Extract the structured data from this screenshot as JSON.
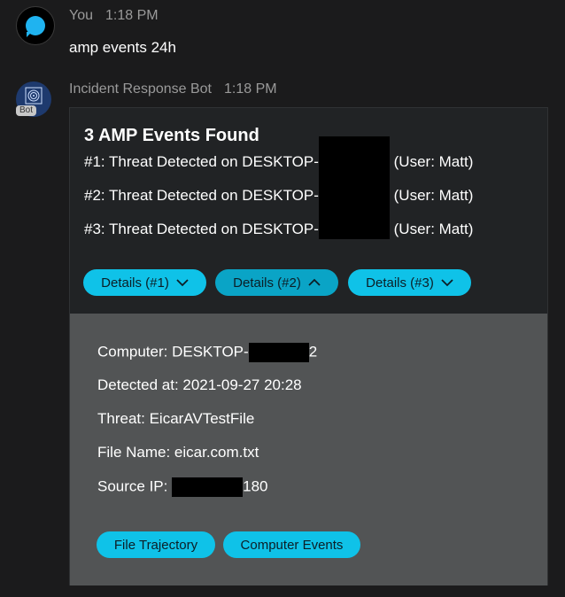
{
  "user_message": {
    "author": "You",
    "time": "1:18 PM",
    "text": "amp events 24h"
  },
  "bot_message": {
    "author": "Incident Response Bot",
    "time": "1:18 PM",
    "bot_badge": "Bot"
  },
  "card": {
    "title": "3 AMP Events Found",
    "events": [
      {
        "prefix": "#1: Threat Detected on DESKTOP-",
        "suffix": "(User: Matt)"
      },
      {
        "prefix": "#2: Threat Detected on DESKTOP-",
        "suffix": "(User: Matt)"
      },
      {
        "prefix": "#3: Threat Detected on DESKTOP-",
        "suffix": "(User: Matt)"
      }
    ],
    "buttons": [
      {
        "label": "Details (#1)",
        "icon": "chevron-down-icon",
        "expanded": false
      },
      {
        "label": "Details (#2)",
        "icon": "chevron-up-icon",
        "expanded": true
      },
      {
        "label": "Details (#3)",
        "icon": "chevron-down-icon",
        "expanded": false
      }
    ]
  },
  "details": {
    "computer_prefix": "Computer: DESKTOP-",
    "computer_suffix": "2",
    "detected_at": "Detected at: 2021-09-27 20:28",
    "threat": "Threat: EicarAVTestFile",
    "file_name": "File Name: eicar.com.txt",
    "source_ip_prefix": "Source IP: ",
    "source_ip_suffix": "180",
    "actions": [
      {
        "label": "File Trajectory"
      },
      {
        "label": "Computer Events"
      }
    ]
  },
  "colors": {
    "background": "#1b1b1c",
    "card": "#212325",
    "details_panel": "#525455",
    "button": "#0fc2e8",
    "button_active": "#0aa4c6",
    "redaction": "#000000"
  }
}
